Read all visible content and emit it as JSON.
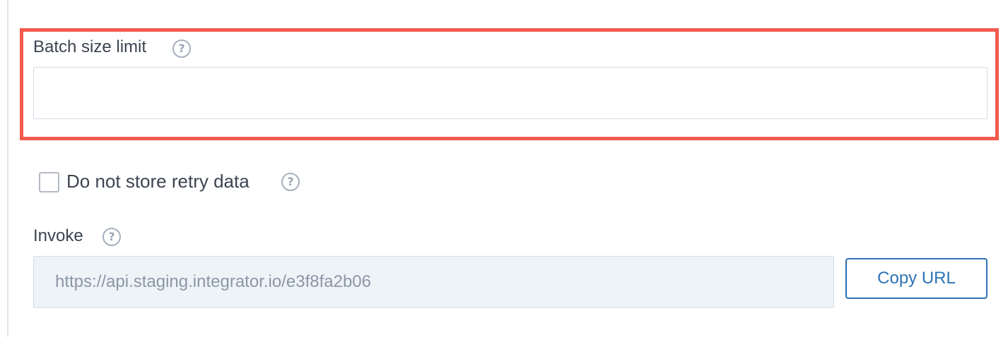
{
  "batch_size": {
    "label": "Batch size limit",
    "help_icon": "question-circle-icon",
    "value": "",
    "placeholder": ""
  },
  "retry": {
    "label": "Do not store retry data",
    "checked": false,
    "help_icon": "question-circle-icon"
  },
  "invoke": {
    "label": "Invoke",
    "help_icon": "question-circle-icon",
    "url": "https://api.staging.integrator.io/e3f8fa2b06",
    "copy_label": "Copy URL"
  },
  "colors": {
    "highlight": "#f25a4d",
    "accent": "#2d72b4",
    "text": "#3c4451",
    "readonly_bg": "#eef3f8"
  }
}
